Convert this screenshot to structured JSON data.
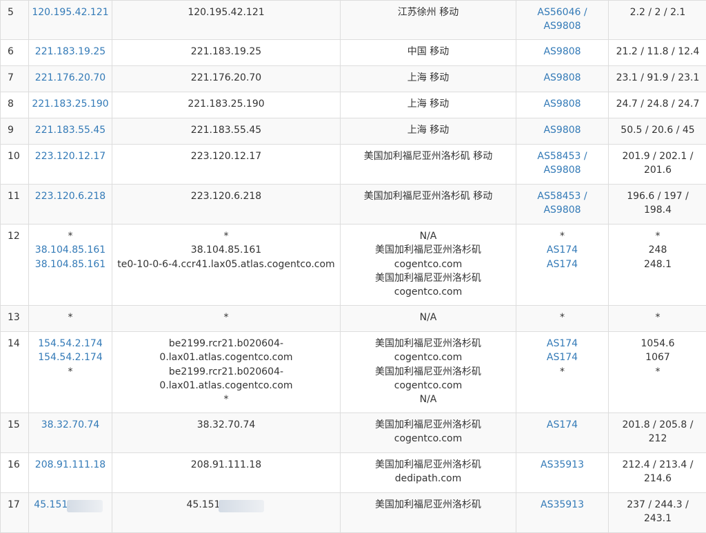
{
  "rows": [
    {
      "hop": "5",
      "ip": [
        "120.195.42.121"
      ],
      "host": [
        "120.195.42.121"
      ],
      "geo": [
        "江苏徐州 移动"
      ],
      "as": [
        "AS56046 /",
        "AS9808"
      ],
      "rtt": [
        "2.2 / 2 / 2.1"
      ]
    },
    {
      "hop": "6",
      "ip": [
        "221.183.19.25"
      ],
      "host": [
        "221.183.19.25"
      ],
      "geo": [
        "中国 移动"
      ],
      "as": [
        "AS9808"
      ],
      "rtt": [
        "21.2 / 11.8 / 12.4"
      ]
    },
    {
      "hop": "7",
      "ip": [
        "221.176.20.70"
      ],
      "host": [
        "221.176.20.70"
      ],
      "geo": [
        "上海 移动"
      ],
      "as": [
        "AS9808"
      ],
      "rtt": [
        "23.1 / 91.9 / 23.1"
      ]
    },
    {
      "hop": "8",
      "ip": [
        "221.183.25.190"
      ],
      "host": [
        "221.183.25.190"
      ],
      "geo": [
        "上海 移动"
      ],
      "as": [
        "AS9808"
      ],
      "rtt": [
        "24.7 / 24.8 / 24.7"
      ]
    },
    {
      "hop": "9",
      "ip": [
        "221.183.55.45"
      ],
      "host": [
        "221.183.55.45"
      ],
      "geo": [
        "上海 移动"
      ],
      "as": [
        "AS9808"
      ],
      "rtt": [
        "50.5 / 20.6 / 45"
      ]
    },
    {
      "hop": "10",
      "ip": [
        "223.120.12.17"
      ],
      "host": [
        "223.120.12.17"
      ],
      "geo": [
        "美国加利福尼亚州洛杉矶 移动"
      ],
      "as": [
        "AS58453 /",
        "AS9808"
      ],
      "rtt": [
        "201.9 / 202.1 /",
        "201.6"
      ]
    },
    {
      "hop": "11",
      "ip": [
        "223.120.6.218"
      ],
      "host": [
        "223.120.6.218"
      ],
      "geo": [
        "美国加利福尼亚州洛杉矶 移动"
      ],
      "as": [
        "AS58453 /",
        "AS9808"
      ],
      "rtt": [
        "196.6 / 197 /",
        "198.4"
      ]
    },
    {
      "hop": "12",
      "ip": [
        "*",
        "38.104.85.161",
        "38.104.85.161"
      ],
      "host": [
        "*",
        "38.104.85.161",
        "te0-10-0-6-4.ccr41.lax05.atlas.cogentco.com"
      ],
      "geo": [
        "N/A",
        "美国加利福尼亚州洛杉矶",
        "cogentco.com",
        "美国加利福尼亚州洛杉矶",
        "cogentco.com"
      ],
      "as": [
        "*",
        "AS174",
        "AS174"
      ],
      "rtt": [
        "*",
        "248",
        "248.1"
      ]
    },
    {
      "hop": "13",
      "ip": [
        "*"
      ],
      "host": [
        "*"
      ],
      "geo": [
        "N/A"
      ],
      "as": [
        "*"
      ],
      "rtt": [
        "*"
      ]
    },
    {
      "hop": "14",
      "ip": [
        "154.54.2.174",
        "154.54.2.174",
        "*"
      ],
      "host": [
        "be2199.rcr21.b020604-",
        "0.lax01.atlas.cogentco.com",
        "be2199.rcr21.b020604-",
        "0.lax01.atlas.cogentco.com",
        "*"
      ],
      "geo": [
        "美国加利福尼亚州洛杉矶",
        "cogentco.com",
        "美国加利福尼亚州洛杉矶",
        "cogentco.com",
        "N/A"
      ],
      "as": [
        "AS174",
        "AS174",
        "*"
      ],
      "rtt": [
        "1054.6",
        "1067",
        "*"
      ]
    },
    {
      "hop": "15",
      "ip": [
        "38.32.70.74"
      ],
      "host": [
        "38.32.70.74"
      ],
      "geo": [
        "美国加利福尼亚州洛杉矶",
        "cogentco.com"
      ],
      "as": [
        "AS174"
      ],
      "rtt": [
        "201.8 / 205.8 /",
        "212"
      ]
    },
    {
      "hop": "16",
      "ip": [
        "208.91.111.18"
      ],
      "host": [
        "208.91.111.18"
      ],
      "geo": [
        "美国加利福尼亚州洛杉矶",
        "dedipath.com"
      ],
      "as": [
        "AS35913"
      ],
      "rtt": [
        "212.4 / 213.4 /",
        "214.6"
      ]
    },
    {
      "hop": "17",
      "ip": [
        "45.151."
      ],
      "host": [
        "45.151"
      ],
      "geo": [
        "美国加利福尼亚州洛杉矶"
      ],
      "as": [
        "AS35913"
      ],
      "rtt": [
        "237 / 244.3 /",
        "243.1"
      ]
    }
  ],
  "colors": {
    "link": "#337ab7",
    "text": "#333333",
    "border": "#dddddd",
    "stripe": "#f9f9f9"
  }
}
